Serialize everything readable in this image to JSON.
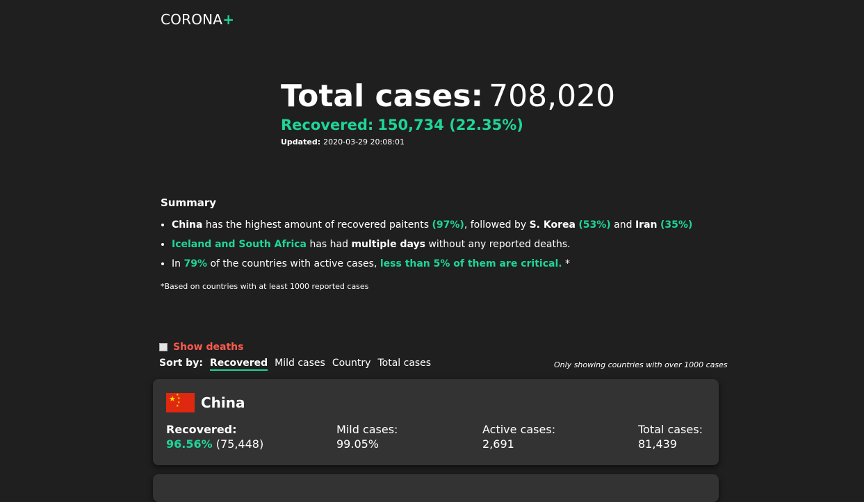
{
  "brand": {
    "name": "CORONA",
    "plus": "+"
  },
  "hero": {
    "total_label": "Total cases:",
    "total_value": "708,020",
    "recovered_label": "Recovered:",
    "recovered_value": "150,734 (22.35%)",
    "updated_label": "Updated:",
    "updated_value": "2020-03-29 20:08:01"
  },
  "summary": {
    "title": "Summary",
    "item1": {
      "c1": "China",
      "t1": "has the highest amount of recovered paitents",
      "p1": "(97%)",
      "t2": ", followed by",
      "c2": "S. Korea",
      "p2": "(53%)",
      "t3": "and",
      "c3": "Iran",
      "p3": "(35%)"
    },
    "item2": {
      "g1": "Iceland and  South Africa",
      "t1": "has had",
      "b1": "multiple days",
      "t2": "without any reported deaths."
    },
    "item3": {
      "t1": "In",
      "g1": "79%",
      "t2": "of the countries with active cases,",
      "g2": "less than 5% of them are critical.",
      "t3": "*"
    },
    "footnote": "*Based on countries with at least 1000 reported cases"
  },
  "controls": {
    "show_deaths": "Show deaths",
    "sort_label": "Sort by:",
    "sort_options": [
      "Recovered",
      "Mild cases",
      "Country",
      "Total cases"
    ],
    "active_sort": "Recovered",
    "note": "Only showing countries with over 1000 cases"
  },
  "countries": [
    {
      "name": "China",
      "recovered_label": "Recovered:",
      "recovered_pct": "96.56%",
      "recovered_count": "(75,448)",
      "mild_label": "Mild cases:",
      "mild_value": "99.05%",
      "active_label": "Active cases:",
      "active_value": "2,691",
      "total_label": "Total cases:",
      "total_value": "81,439"
    }
  ],
  "colors": {
    "accent": "#1ed59a",
    "deaths": "#ff5a4e",
    "background": "#1f1f1f",
    "card": "#333333"
  },
  "icons": {
    "flag": "china-flag-icon"
  }
}
